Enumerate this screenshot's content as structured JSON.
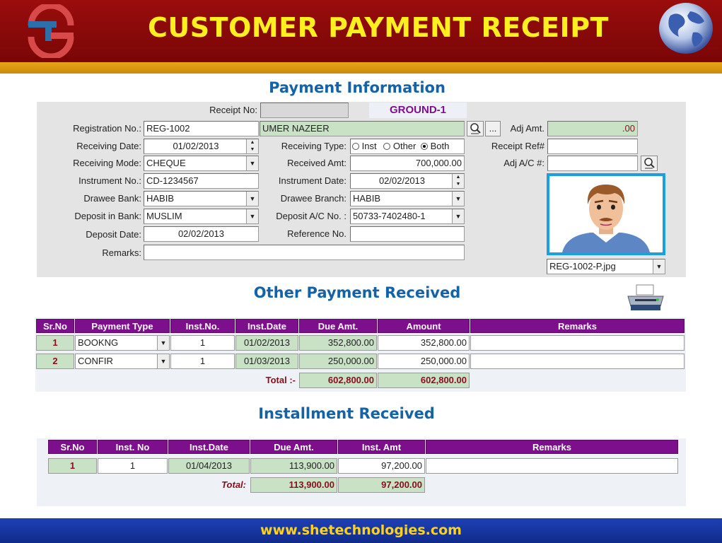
{
  "header": {
    "title": "CUSTOMER PAYMENT RECEIPT"
  },
  "footer": {
    "website": "www.shetechnologies.com"
  },
  "payment_info": {
    "title": "Payment Information",
    "receipt_no_label": "Receipt No:",
    "receipt_no_value": "",
    "location": "GROUND-1",
    "registration_no_label": "Registration No.:",
    "registration_no_value": "REG-1002",
    "customer_name": "UMER NAZEER",
    "more_button": "...",
    "adj_amt_label": "Adj Amt.",
    "adj_amt_value": ".00",
    "receiving_date_label": "Receiving Date:",
    "receiving_date_value": "01/02/2013",
    "receiving_type_label": "Receiving Type:",
    "receiving_type_options": [
      "Inst",
      "Other",
      "Both"
    ],
    "receiving_type_selected": "Both",
    "receipt_ref_label": "Receipt Ref#",
    "receipt_ref_value": "",
    "receiving_mode_label": "Receiving Mode:",
    "receiving_mode_value": "CHEQUE",
    "received_amt_label": "Received Amt:",
    "received_amt_value": "700,000.00",
    "adj_ac_label": "Adj A/C #:",
    "adj_ac_value": "",
    "instrument_no_label": "Instrument No.:",
    "instrument_no_value": "CD-1234567",
    "instrument_date_label": "Instrument Date:",
    "instrument_date_value": "02/02/2013",
    "drawee_bank_label": "Drawee Bank:",
    "drawee_bank_value": "HABIB",
    "drawee_branch_label": "Drawee Branch:",
    "drawee_branch_value": "HABIB",
    "deposit_bank_label": "Deposit in Bank:",
    "deposit_bank_value": "MUSLIM",
    "deposit_ac_label": "Deposit A/C No. :",
    "deposit_ac_value": "50733-7402480-1",
    "deposit_date_label": "Deposit Date:",
    "deposit_date_value": "02/02/2013",
    "reference_no_label": "Reference No.",
    "reference_no_value": "",
    "remarks_label": "Remarks:",
    "remarks_value": "",
    "photo_file": "REG-1002-P.jpg"
  },
  "other_payment": {
    "title": "Other Payment Received",
    "columns": [
      "Sr.No",
      "Payment Type",
      "Inst.No.",
      "Inst.Date",
      "Due Amt.",
      "Amount",
      "Remarks"
    ],
    "rows": [
      {
        "sr": "1",
        "type": "BOOKNG",
        "inst_no": "1",
        "inst_date": "01/02/2013",
        "due": "352,800.00",
        "amount": "352,800.00",
        "remarks": ""
      },
      {
        "sr": "2",
        "type": "CONFIR",
        "inst_no": "1",
        "inst_date": "01/03/2013",
        "due": "250,000.00",
        "amount": "250,000.00",
        "remarks": ""
      }
    ],
    "total_label": "Total :-",
    "total_due": "602,800.00",
    "total_amount": "602,800.00"
  },
  "installment": {
    "title": "Installment Received",
    "columns": [
      "Sr.No",
      "Inst. No",
      "Inst.Date",
      "Due Amt.",
      "Inst. Amt",
      "Remarks"
    ],
    "rows": [
      {
        "sr": "1",
        "inst_no": "1",
        "inst_date": "01/04/2013",
        "due": "113,900.00",
        "amount": "97,200.00",
        "remarks": ""
      }
    ],
    "total_label": "Total:",
    "total_due": "113,900.00",
    "total_amount": "97,200.00"
  },
  "colors": {
    "header_bg": "#8b0a0a",
    "header_title": "#ffef1f",
    "stripe": "#e0a010",
    "section_title": "#1462a8",
    "table_header": "#7d0f8c",
    "field_green": "#c9e2c6",
    "footer_bg": "#1a3aa8",
    "footer_text": "#ffd21a"
  },
  "icons": [
    "logo-icon",
    "globe-icon",
    "search-icon",
    "printer-icon",
    "customer-photo"
  ]
}
